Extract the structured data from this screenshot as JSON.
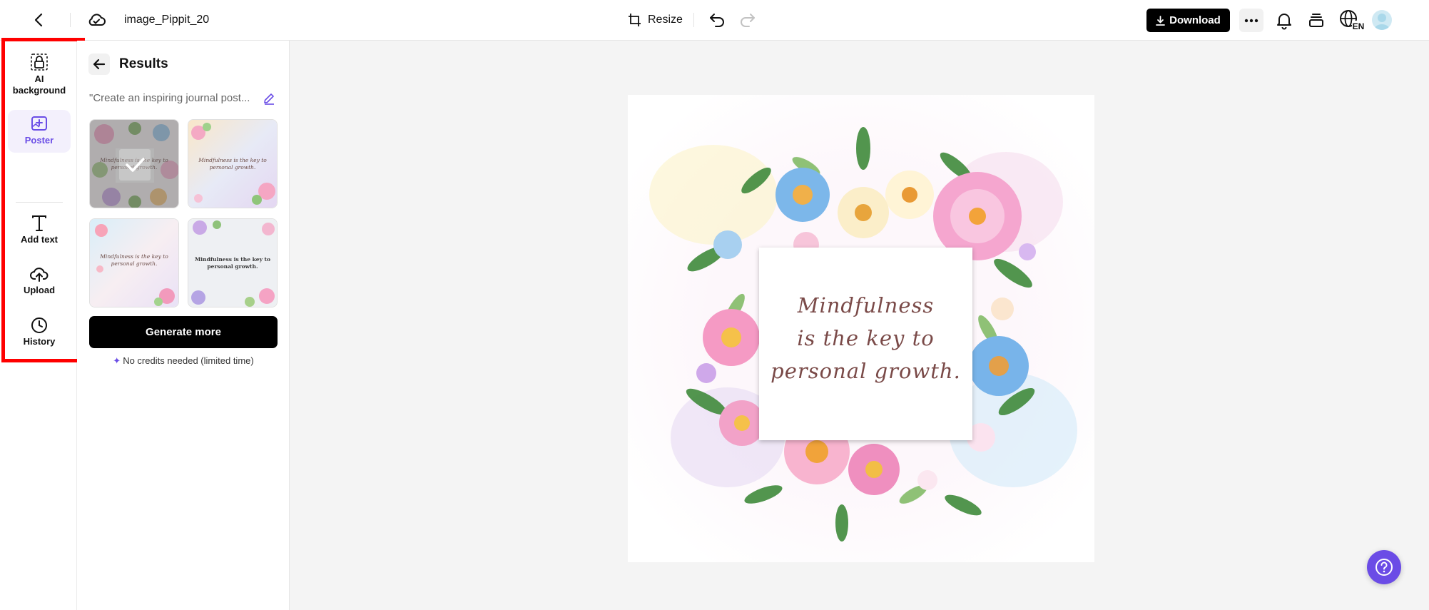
{
  "header": {
    "file_name": "image_Pippit_20",
    "resize_label": "Resize",
    "download_label": "Download",
    "language_code": "EN"
  },
  "tools": [
    {
      "label": "AI background",
      "icon": "ai-background-icon",
      "active": false
    },
    {
      "label": "Poster",
      "icon": "poster-icon",
      "active": true
    },
    {
      "label": "Add text",
      "icon": "text-icon",
      "active": false
    },
    {
      "label": "Upload",
      "icon": "upload-icon",
      "active": false
    },
    {
      "label": "History",
      "icon": "history-icon",
      "active": false
    }
  ],
  "panel": {
    "title": "Results",
    "prompt": "\"Create an inspiring journal post...",
    "results": [
      {
        "caption": "Mindfulness is the key to personal growth.",
        "selected": true
      },
      {
        "caption": "Mindfulness is the key to personal growth.",
        "selected": false
      },
      {
        "caption": "Mindfulness is the key to personal growth.",
        "selected": false
      },
      {
        "caption": "Mindfulness is the key to personal growth.",
        "selected": false
      }
    ],
    "generate_label": "Generate more",
    "credits_note": "No credits needed (limited time)"
  },
  "canvas": {
    "poster_text_line1": "Mindfulness",
    "poster_text_line2": "is the key to",
    "poster_text_line3": "personal growth."
  },
  "colors": {
    "accent": "#6b4ce6",
    "highlight_border": "#ff0000",
    "canvas_bg": "#f4f4f4"
  }
}
